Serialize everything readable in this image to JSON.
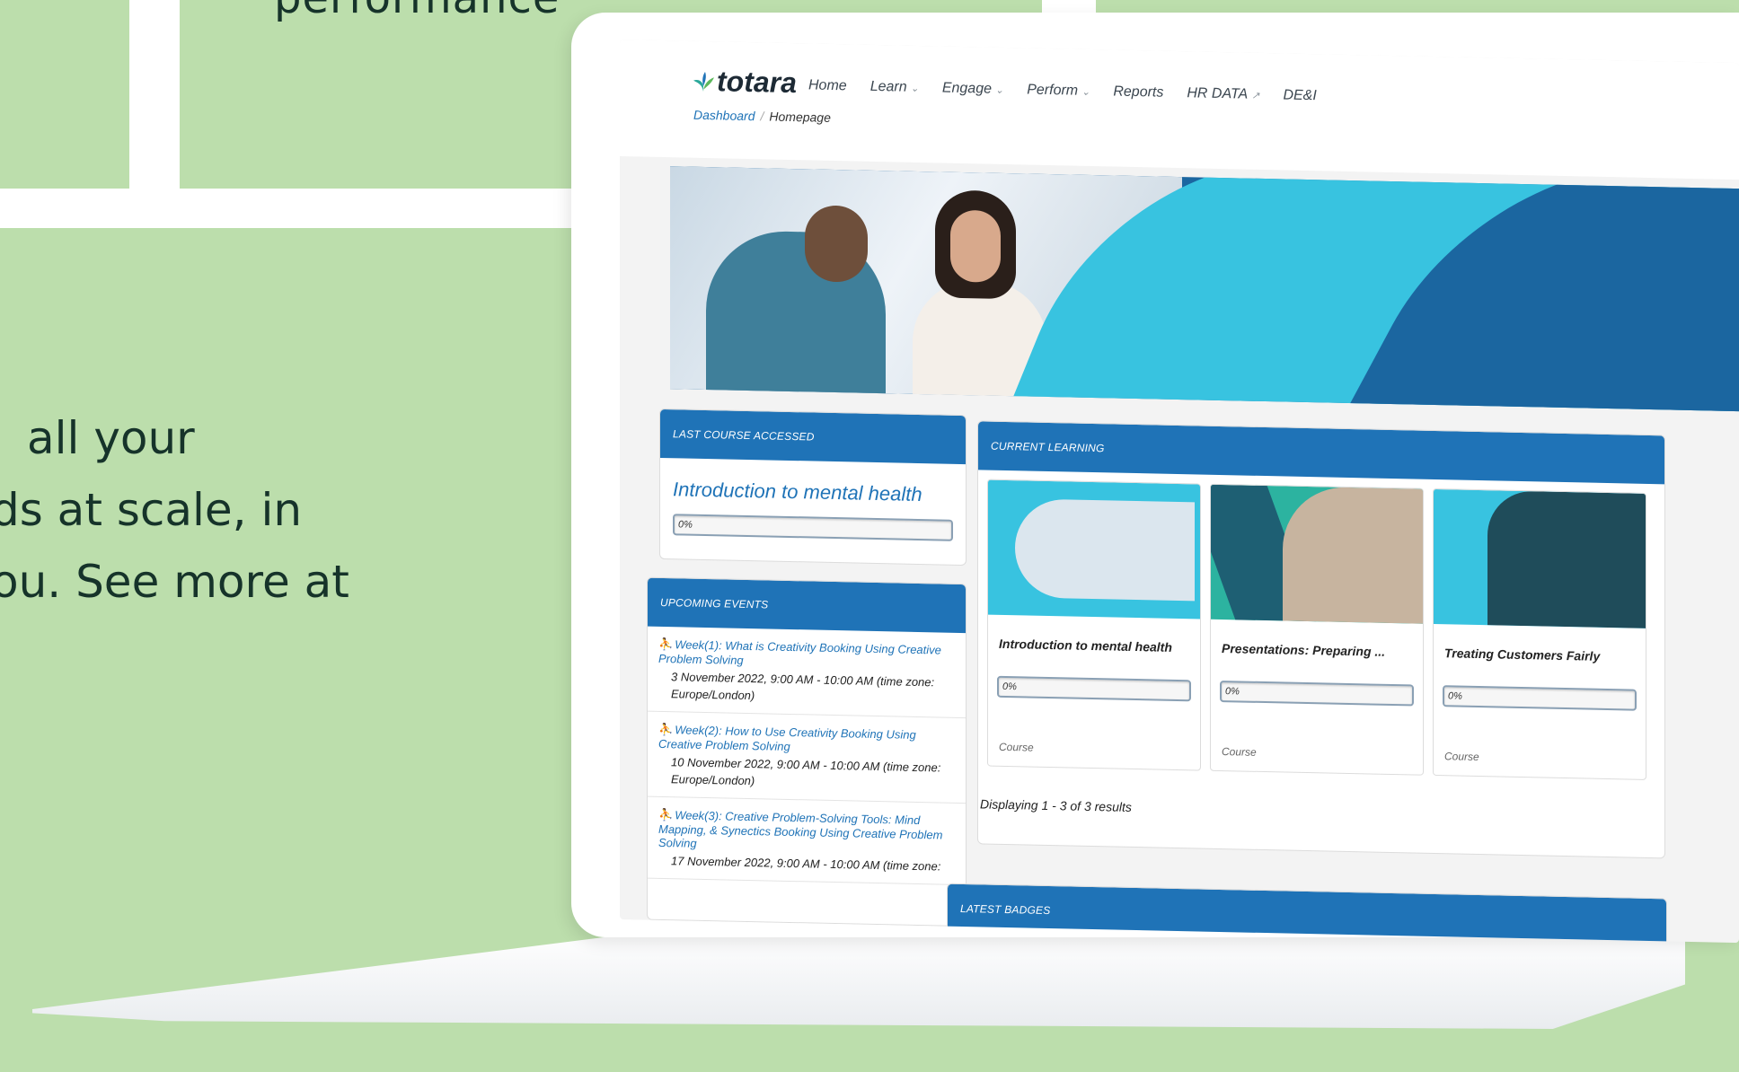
{
  "marketing": {
    "top_word": "performance",
    "side_lines": [
      "all your",
      "ds at scale, in",
      "ou. See more at"
    ]
  },
  "nav": {
    "logo_text": "totara",
    "menu": [
      {
        "label": "Home",
        "dropdown": false
      },
      {
        "label": "Learn",
        "dropdown": true
      },
      {
        "label": "Engage",
        "dropdown": true
      },
      {
        "label": "Perform",
        "dropdown": true
      },
      {
        "label": "Reports",
        "dropdown": false
      },
      {
        "label": "HR DATA",
        "dropdown": false,
        "external": true
      },
      {
        "label": "DE&I",
        "dropdown": false
      }
    ]
  },
  "breadcrumb": {
    "parent": "Dashboard",
    "current": "Homepage"
  },
  "last_course": {
    "heading": "LAST COURSE ACCESSED",
    "title": "Introduction to mental health",
    "progress_label": "0%",
    "progress": 0
  },
  "events": {
    "heading": "UPCOMING EVENTS",
    "items": [
      {
        "link": "Week(1): What is Creativity Booking Using Creative Problem Solving",
        "time": "3 November 2022, 9:00 AM - 10:00 AM (time zone: Europe/London)"
      },
      {
        "link": "Week(2): How to Use Creativity Booking Using Creative Problem Solving",
        "time": "10 November 2022, 9:00 AM - 10:00 AM (time zone: Europe/London)"
      },
      {
        "link": "Week(3): Creative Problem-Solving Tools: Mind Mapping, & Synectics Booking Using Creative Problem Solving",
        "time": "17 November 2022, 9:00 AM - 10:00 AM (time zone:"
      }
    ]
  },
  "current_learning": {
    "heading": "CURRENT LEARNING",
    "cards": [
      {
        "title": "Introduction to mental health",
        "progress_label": "0%",
        "type": "Course"
      },
      {
        "title": "Presentations: Preparing ...",
        "progress_label": "0%",
        "type": "Course"
      },
      {
        "title": "Treating Customers Fairly",
        "progress_label": "0%",
        "type": "Course"
      }
    ],
    "results": "Displaying 1 - 3 of 3 results"
  },
  "badges": {
    "heading": "LATEST BADGES"
  },
  "colors": {
    "primary": "#1f73b7",
    "accent": "#38c3e0",
    "background": "#bcdeac"
  }
}
